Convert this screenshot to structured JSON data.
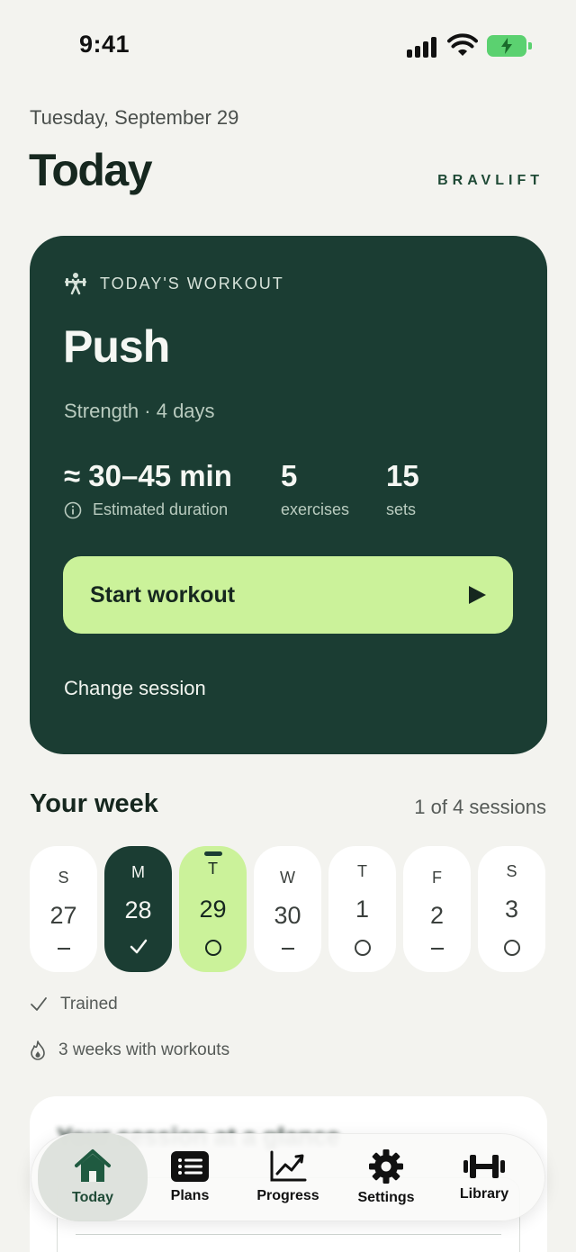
{
  "status": {
    "time": "9:41"
  },
  "header": {
    "date": "Tuesday, September 29",
    "title": "Today",
    "brand": "BRAVLIFT"
  },
  "workout": {
    "eyebrow": "TODAY'S WORKOUT",
    "name": "Push",
    "subtitle": "Strength · 4 days",
    "duration_value": "≈ 30–45 min",
    "duration_label": "Estimated duration",
    "exercises_value": "5",
    "exercises_label": "exercises",
    "sets_value": "15",
    "sets_label": "sets",
    "start_label": "Start workout",
    "change_label": "Change session"
  },
  "week": {
    "title": "Your week",
    "count": "1 of 4 sessions",
    "days": [
      {
        "name": "S",
        "date": "27",
        "state": "rest"
      },
      {
        "name": "M",
        "date": "28",
        "state": "done"
      },
      {
        "name": "T",
        "date": "29",
        "state": "today"
      },
      {
        "name": "W",
        "date": "30",
        "state": "rest"
      },
      {
        "name": "T",
        "date": "1",
        "state": "planned"
      },
      {
        "name": "F",
        "date": "2",
        "state": "rest"
      },
      {
        "name": "S",
        "date": "3",
        "state": "planned"
      }
    ],
    "legend_trained": "Trained",
    "streak": "3 weeks with workouts"
  },
  "next_card": {
    "title": "Your session at a glance"
  },
  "tabs": [
    {
      "label": "Today",
      "icon": "home-icon",
      "active": true
    },
    {
      "label": "Plans",
      "icon": "list-icon",
      "active": false
    },
    {
      "label": "Progress",
      "icon": "chart-icon",
      "active": false
    },
    {
      "label": "Settings",
      "icon": "gear-icon",
      "active": false
    },
    {
      "label": "Library",
      "icon": "dumbbell-icon",
      "active": false
    }
  ],
  "colors": {
    "accent_dark": "#1b3d33",
    "accent_light": "#cbf29a",
    "background": "#f3f3ef"
  }
}
